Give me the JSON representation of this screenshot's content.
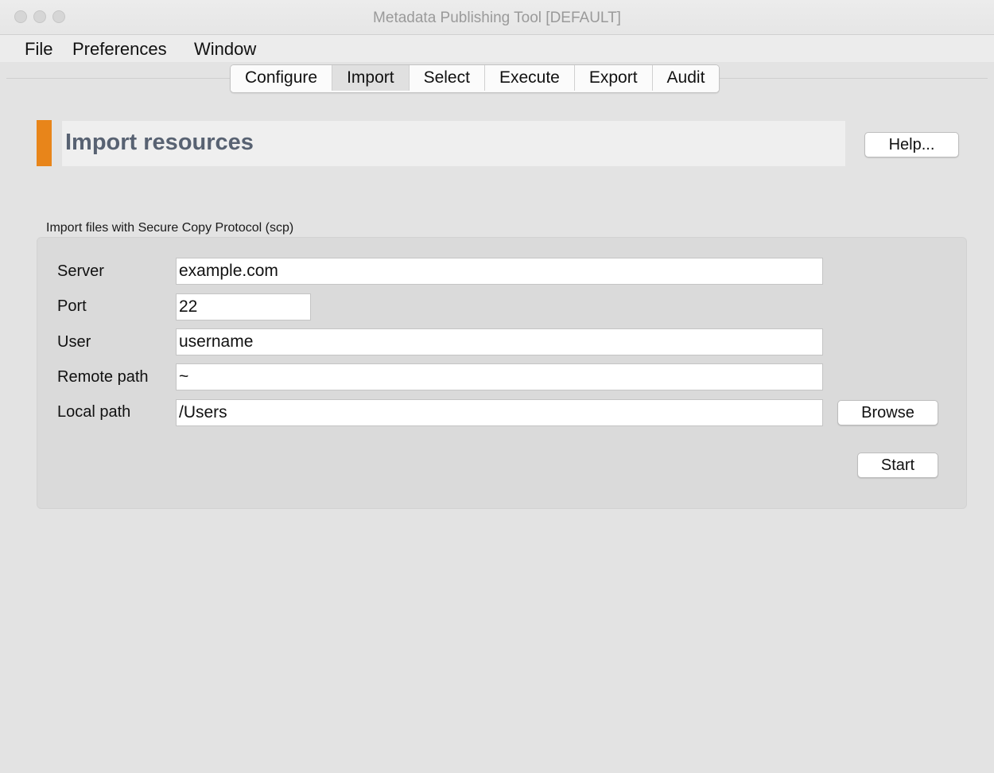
{
  "window": {
    "title": "Metadata Publishing Tool [DEFAULT]"
  },
  "menu": {
    "items": [
      "File",
      "Preferences",
      "Window"
    ]
  },
  "tabs": {
    "items": [
      "Configure",
      "Import",
      "Select",
      "Execute",
      "Export",
      "Audit"
    ],
    "active": "Import"
  },
  "header": {
    "title": "Import resources",
    "help_label": "Help...",
    "accent_color": "#e8851a"
  },
  "scp": {
    "section_label": "Import files with Secure Copy Protocol (scp)",
    "server": {
      "label": "Server",
      "value": "example.com"
    },
    "port": {
      "label": "Port",
      "value": "22"
    },
    "user": {
      "label": "User",
      "value": "username"
    },
    "remote_path": {
      "label": "Remote path",
      "value": "~"
    },
    "local_path": {
      "label": "Local path",
      "value": "/Users"
    },
    "browse_label": "Browse",
    "start_label": "Start"
  }
}
